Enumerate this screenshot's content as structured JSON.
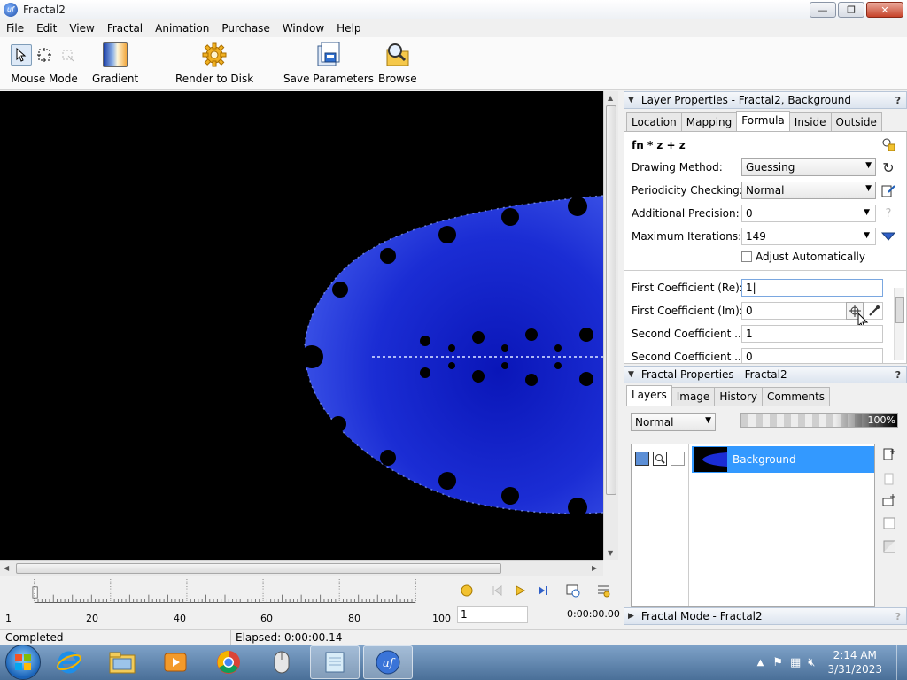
{
  "window": {
    "title": "Fractal2",
    "app_icon": "uf",
    "min_glyph": "—",
    "max_glyph": "❐",
    "close_glyph": "✕"
  },
  "menu": [
    "File",
    "Edit",
    "View",
    "Fractal",
    "Animation",
    "Purchase",
    "Window",
    "Help"
  ],
  "toolbar": {
    "mouse_mode": "Mouse Mode",
    "gradient": "Gradient",
    "render_to_disk": "Render to Disk",
    "save_parameters": "Save Parameters",
    "browse": "Browse"
  },
  "timeline": {
    "tick_labels": [
      "1",
      "20",
      "40",
      "60",
      "80",
      "100"
    ],
    "frame_value": "1",
    "time": "0:00:00.00"
  },
  "status": {
    "left": "Completed",
    "elapsed": "Elapsed: 0:00:00.14"
  },
  "layer_props": {
    "header": "Layer Properties - Fractal2, Background",
    "help": "?",
    "tabs": [
      "Location",
      "Mapping",
      "Formula",
      "Inside",
      "Outside"
    ],
    "active_tab": "Formula",
    "formula": "fn * z + z",
    "drawing_method_label": "Drawing Method:",
    "drawing_method_value": "Guessing",
    "periodicity_label": "Periodicity Checking:",
    "periodicity_value": "Normal",
    "precision_label": "Additional Precision:",
    "precision_value": "0",
    "iterations_label": "Maximum Iterations:",
    "iterations_value": "149",
    "adjust_label": "Adjust Automatically",
    "first_re_label": "First Coefficient (Re):",
    "first_re_value": "1",
    "first_im_label": "First Coefficient (Im):",
    "first_im_value": "0",
    "second_label": "Second Coefficient ...",
    "second_value": "1",
    "second2_label": "Second Coefficient ...",
    "second2_value": "0"
  },
  "fractal_props": {
    "header": "Fractal Properties - Fractal2",
    "help": "?",
    "tabs": [
      "Layers",
      "Image",
      "History",
      "Comments"
    ],
    "active_tab": "Layers",
    "blend_mode": "Normal",
    "opacity": "100%",
    "layer_name": "Background"
  },
  "fractal_mode": {
    "header": "Fractal Mode - Fractal2",
    "help": "?"
  },
  "taskbar": {
    "time": "2:14 AM",
    "date": "3/31/2023"
  },
  "colors": {
    "fractal_blue": "#1a2bd0",
    "selection": "#3399ff",
    "canvas": "#000000"
  }
}
